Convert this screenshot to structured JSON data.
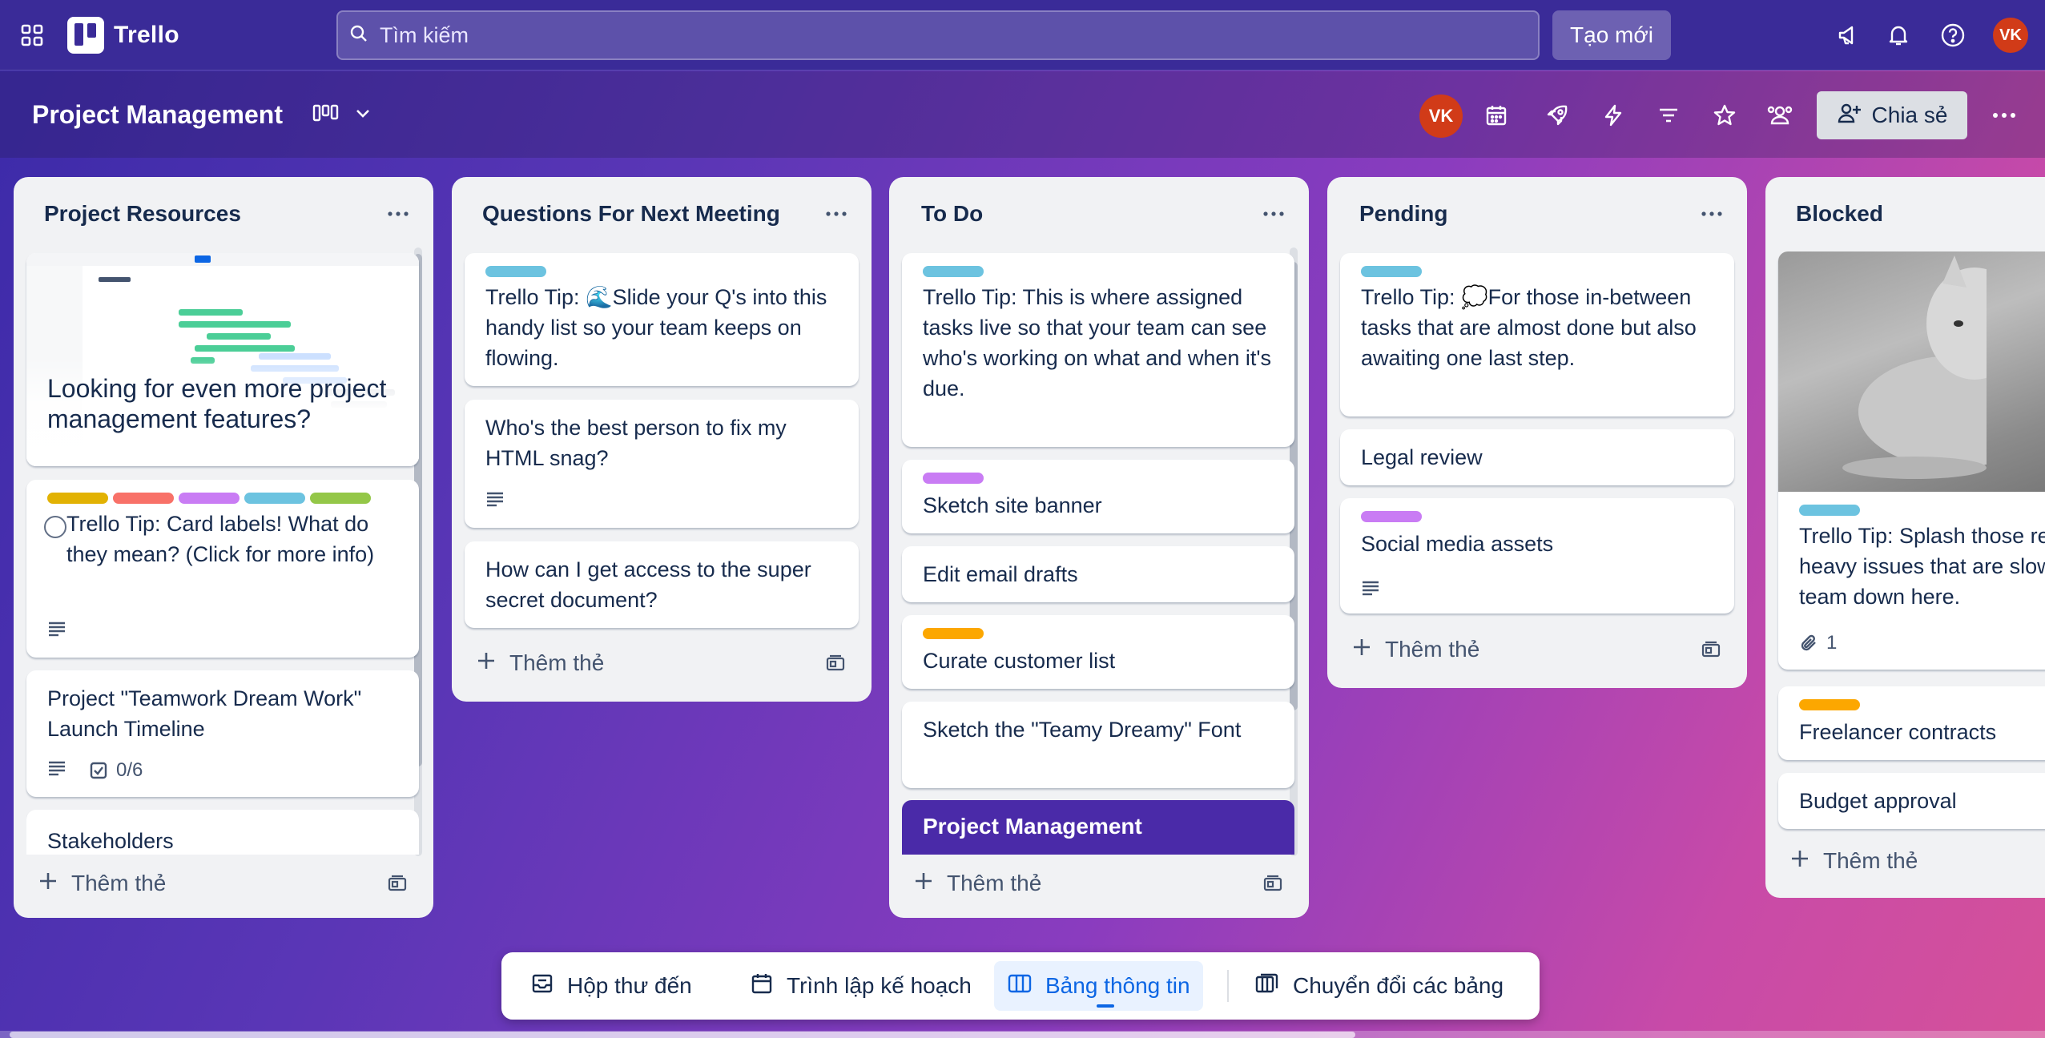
{
  "topbar": {
    "app_name": "Trello",
    "search_placeholder": "Tìm kiếm",
    "create_label": "Tạo mới",
    "avatar_initials": "VK"
  },
  "board": {
    "title": "Project Management",
    "member_initials": "VK",
    "share_label": "Chia sẻ"
  },
  "lists": [
    {
      "title": "Project Resources",
      "cards": [
        {
          "title": "Looking for even more project management features?",
          "cover": "timeline-screenshot"
        },
        {
          "title": "Trello Tip: Card labels! What do they mean? (Click for more info)",
          "labels": [
            "yellow",
            "red",
            "purple",
            "sky",
            "lime"
          ],
          "badges": [
            "description"
          ]
        },
        {
          "title": "Project \"Teamwork Dream Work\" Launch Timeline",
          "badges": [
            "description"
          ],
          "checklist": "0/6"
        },
        {
          "title": "Stakeholders"
        }
      ],
      "add_label": "Thêm thẻ"
    },
    {
      "title": "Questions For Next Meeting",
      "cards": [
        {
          "title": "Trello Tip: 🌊Slide your Q's into this handy list so your team keeps on flowing.",
          "labels": [
            "sky"
          ]
        },
        {
          "title": "Who's the best person to fix my HTML snag?",
          "badges": [
            "description"
          ]
        },
        {
          "title": "How can I get access to the super secret document?"
        }
      ],
      "add_label": "Thêm thẻ"
    },
    {
      "title": "To Do",
      "cards": [
        {
          "title": "Trello Tip: This is where assigned tasks live so that your team can see who's working on what and when it's due.",
          "labels": [
            "sky"
          ]
        },
        {
          "title": "Sketch site banner",
          "labels": [
            "purple"
          ]
        },
        {
          "title": "Edit email drafts"
        },
        {
          "title": "Curate customer list",
          "labels": [
            "orange"
          ]
        },
        {
          "title": "Sketch the \"Teamy Dreamy\" Font"
        },
        {
          "title": "Project Management"
        }
      ],
      "add_label": "Thêm thẻ"
    },
    {
      "title": "Pending",
      "cards": [
        {
          "title": "Trello Tip: 💭For those in-between tasks that are almost done but also awaiting one last step.",
          "labels": [
            "sky"
          ]
        },
        {
          "title": "Legal review"
        },
        {
          "title": "Social media assets",
          "labels": [
            "purple"
          ],
          "badges": [
            "description"
          ]
        }
      ],
      "add_label": "Thêm thẻ"
    },
    {
      "title": "Blocked",
      "cards": [
        {
          "title": "Trello Tip: Splash those redtape-heavy issues that are slowing your team down here.",
          "labels": [
            "sky"
          ],
          "attachments": "1",
          "cover": "cat-photo"
        },
        {
          "title": "Freelancer contracts",
          "labels": [
            "orange"
          ]
        },
        {
          "title": "Budget approval"
        }
      ],
      "add_label": "Thêm thẻ"
    }
  ],
  "bottom_nav": [
    {
      "label": "Hộp thư đến",
      "icon": "inbox-icon"
    },
    {
      "label": "Trình lập kế hoạch",
      "icon": "calendar-icon"
    },
    {
      "label": "Bảng thông tin",
      "icon": "board-icon",
      "active": true
    },
    {
      "label": "Chuyển đổi các bảng",
      "icon": "switch-boards-icon"
    }
  ],
  "colors": {
    "topbar": "#3a2b98",
    "label_yellow": "#e2b203",
    "label_red": "#f87168",
    "label_purple": "#c97cf4",
    "label_sky": "#6cc3e0",
    "label_lime": "#94c748",
    "label_orange": "#fca700",
    "active_blue": "#0c66e4",
    "highlight_card": "#4a2aa8"
  }
}
